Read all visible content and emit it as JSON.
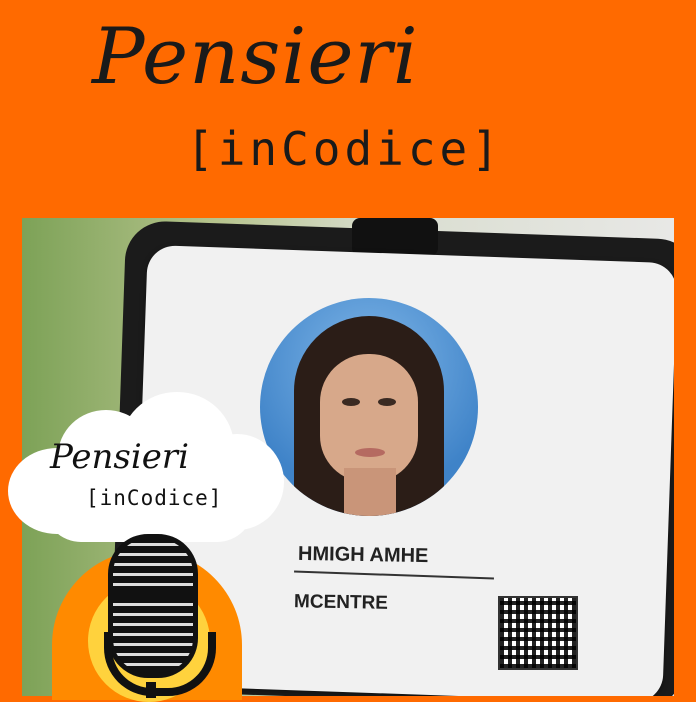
{
  "header": {
    "title": "Pensieri",
    "subtitle": "[inCodice]"
  },
  "badge": {
    "name": "HMIGH AMHE",
    "department": "MCENTRE"
  },
  "logo": {
    "title": "Pensieri",
    "subtitle": "[inCodice]",
    "icon": "microphone-icon"
  },
  "colors": {
    "background": "#ff6a00",
    "accent_yellow": "#ffd23d",
    "accent_orange": "#ff8a00"
  }
}
